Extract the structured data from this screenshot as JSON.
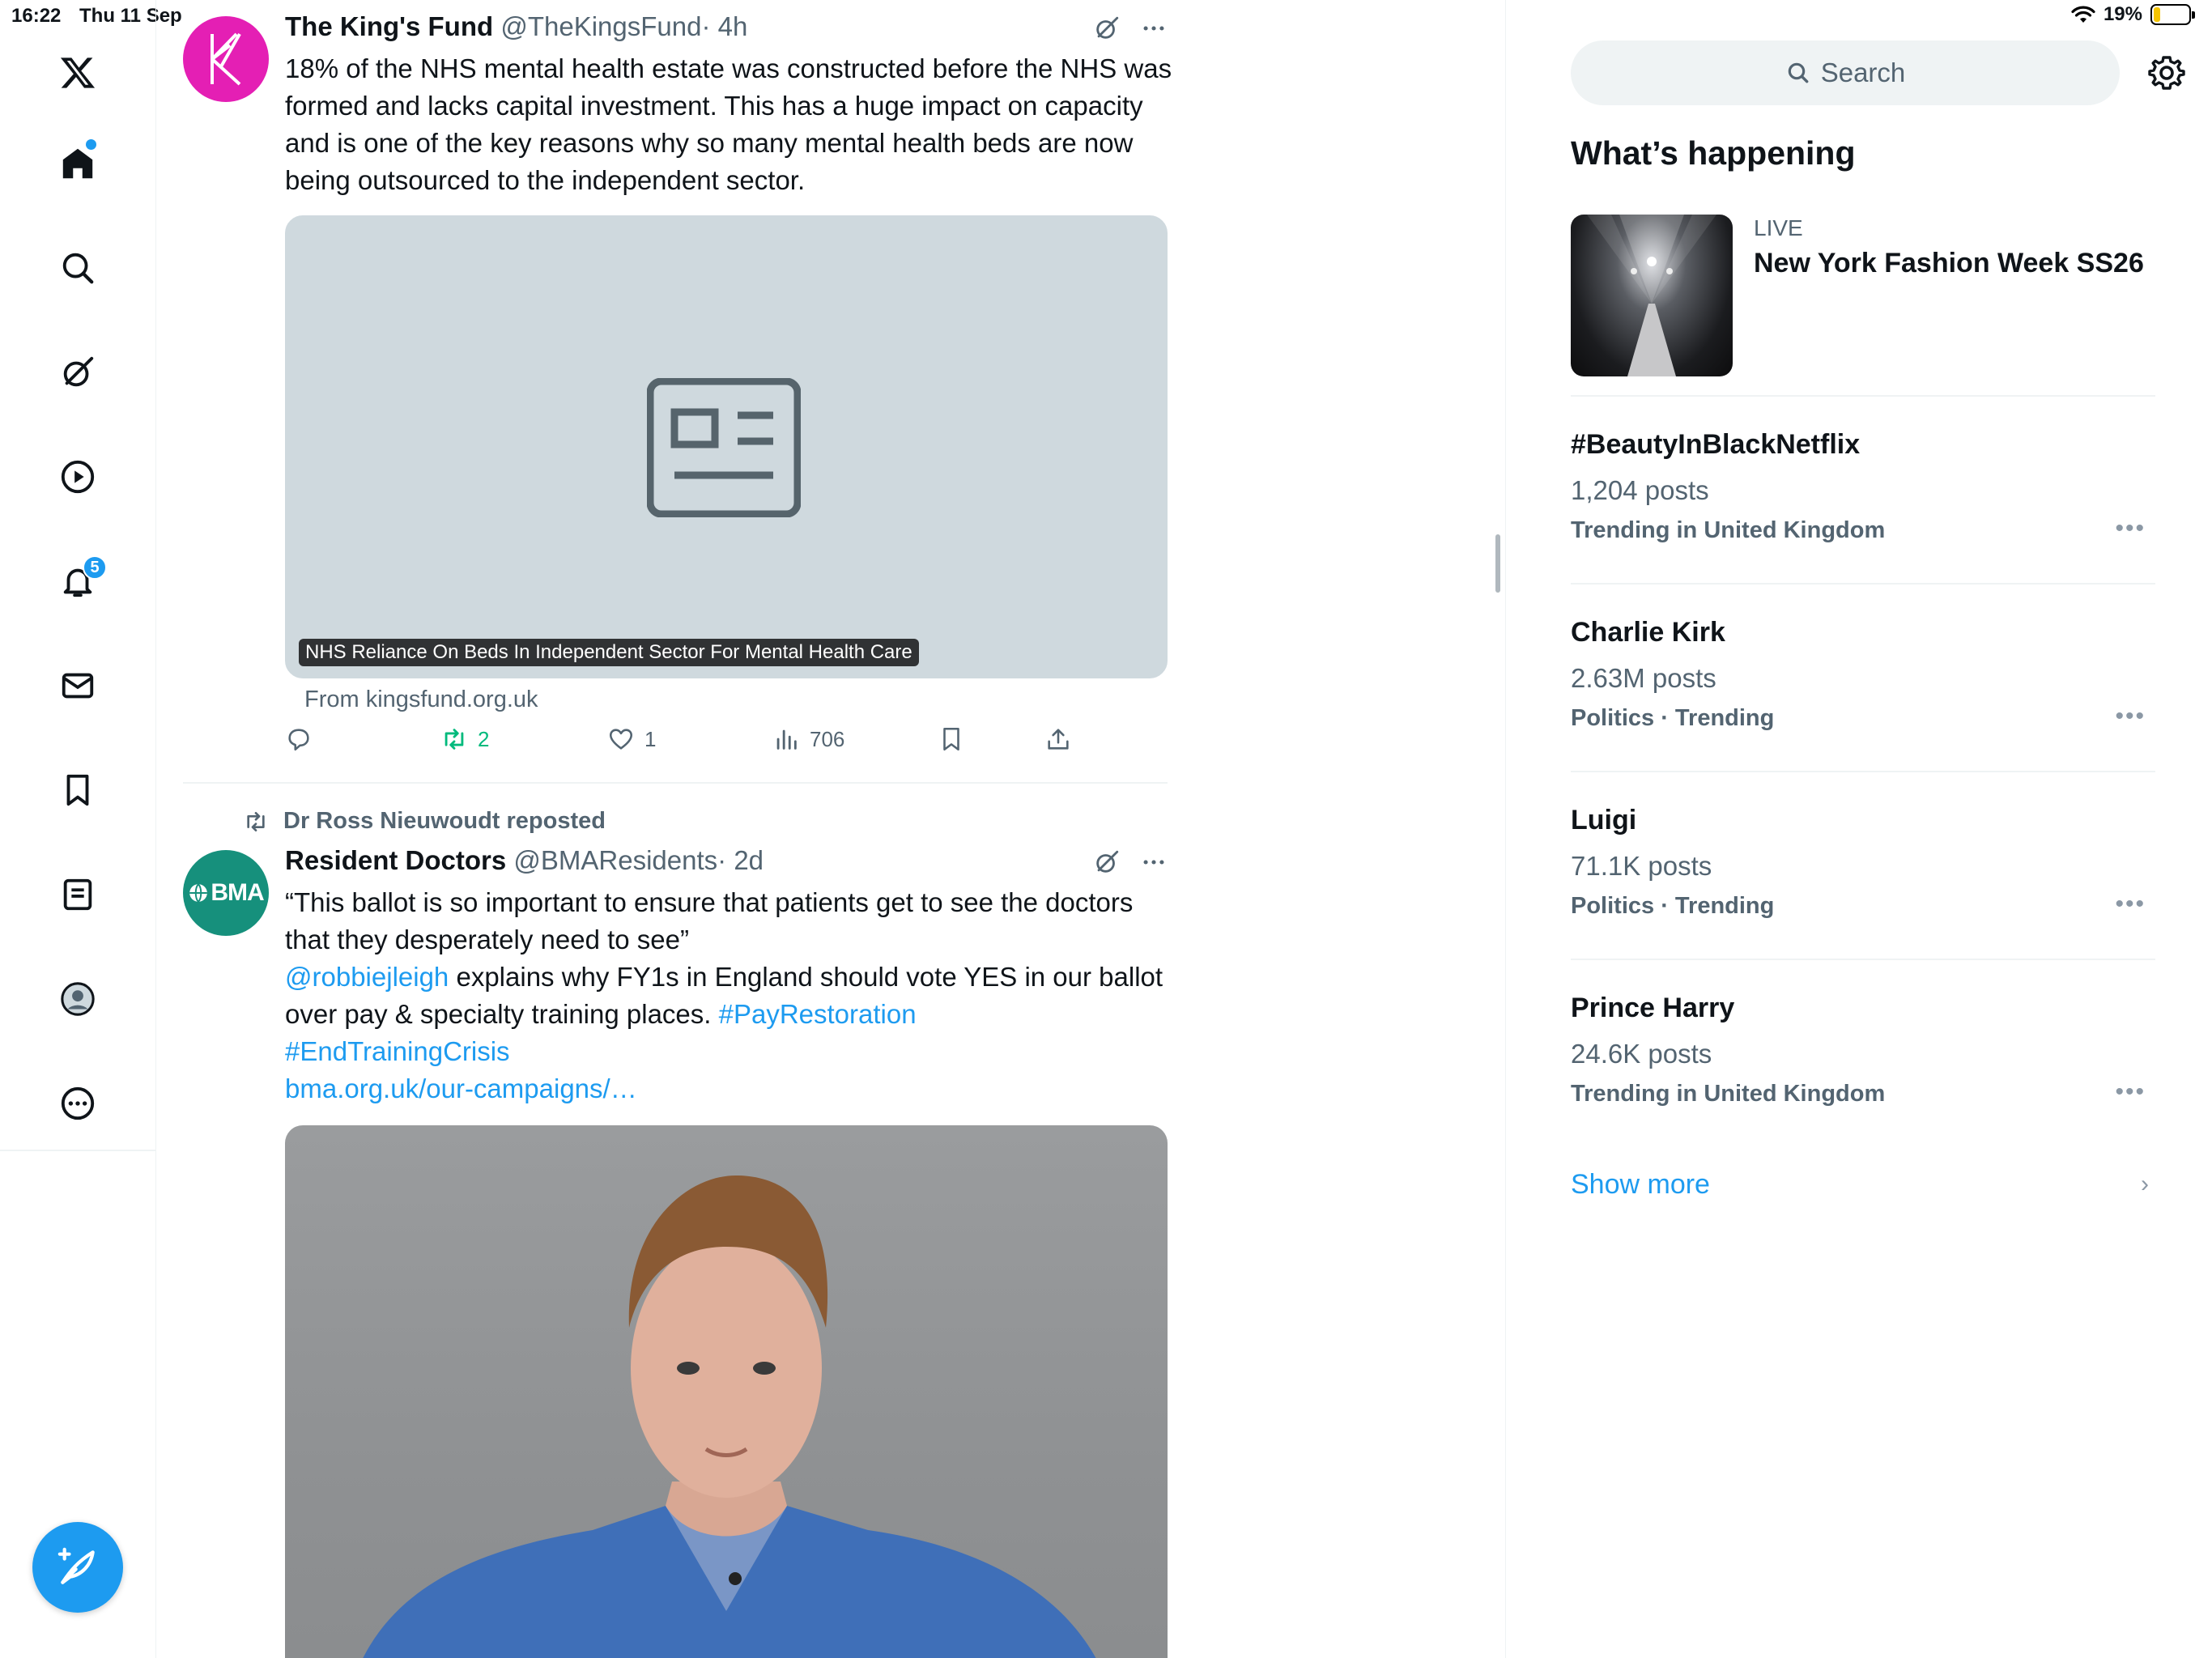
{
  "status_bar": {
    "time": "16:22",
    "date": "Thu 11 Sep",
    "battery": "19%",
    "battery_level": 0.19
  },
  "nav": {
    "notifications_badge": "5",
    "accent": "#1d9bf0",
    "icons": [
      "x-logo-icon",
      "home-icon",
      "search-icon",
      "grok-icon",
      "video-icon",
      "bell-icon",
      "mail-icon",
      "bookmark-icon",
      "lists-icon",
      "profile-icon",
      "more-icon"
    ]
  },
  "tweets": [
    {
      "name": "The King's Fund",
      "handle": "@TheKingsFund",
      "time": "· 4h",
      "text": "18% of the NHS mental health estate was constructed before the NHS was formed and lacks capital investment. This has a huge impact on capacity and is one of the key reasons why so many mental health beds are now being outsourced to the independent sector.",
      "card_caption": "NHS Reliance On Beds In Independent Sector For Mental Health Care",
      "card_source": "From kingsfund.org.uk",
      "retweets": "2",
      "likes": "1",
      "views": "706"
    },
    {
      "reposted_by": "Dr Ross Nieuwoudt reposted",
      "avatar_text": "BMA",
      "name": "Resident Doctors",
      "handle": "@BMAResidents",
      "time": "· 2d",
      "text_line1": "“This ballot is so important to ensure that patients get to see the doctors that they desperately need to see”",
      "mention": "@robbiejleigh",
      "text_line2": " explains why FY1s in England should vote YES in our ballot over pay & specialty training places. ",
      "hashtag1": "#PayRestoration",
      "hashtag2": "#EndTrainingCrisis",
      "url": "bma.org.uk/our-campaigns/…"
    }
  ],
  "sidebar": {
    "search_placeholder": "Search",
    "title": "What’s happening",
    "live": {
      "label": "LIVE",
      "title": "New York Fashion Week SS26"
    },
    "trends": [
      {
        "title": "#BeautyInBlackNetflix",
        "posts": "1,204 posts",
        "context": "Trending in United Kingdom"
      },
      {
        "title": "Charlie Kirk",
        "posts": "2.63M posts",
        "context": "Politics · Trending"
      },
      {
        "title": "Luigi",
        "posts": "71.1K posts",
        "context": "Politics · Trending"
      },
      {
        "title": "Prince Harry",
        "posts": "24.6K posts",
        "context": "Trending in United Kingdom"
      }
    ],
    "show_more": "Show more"
  }
}
